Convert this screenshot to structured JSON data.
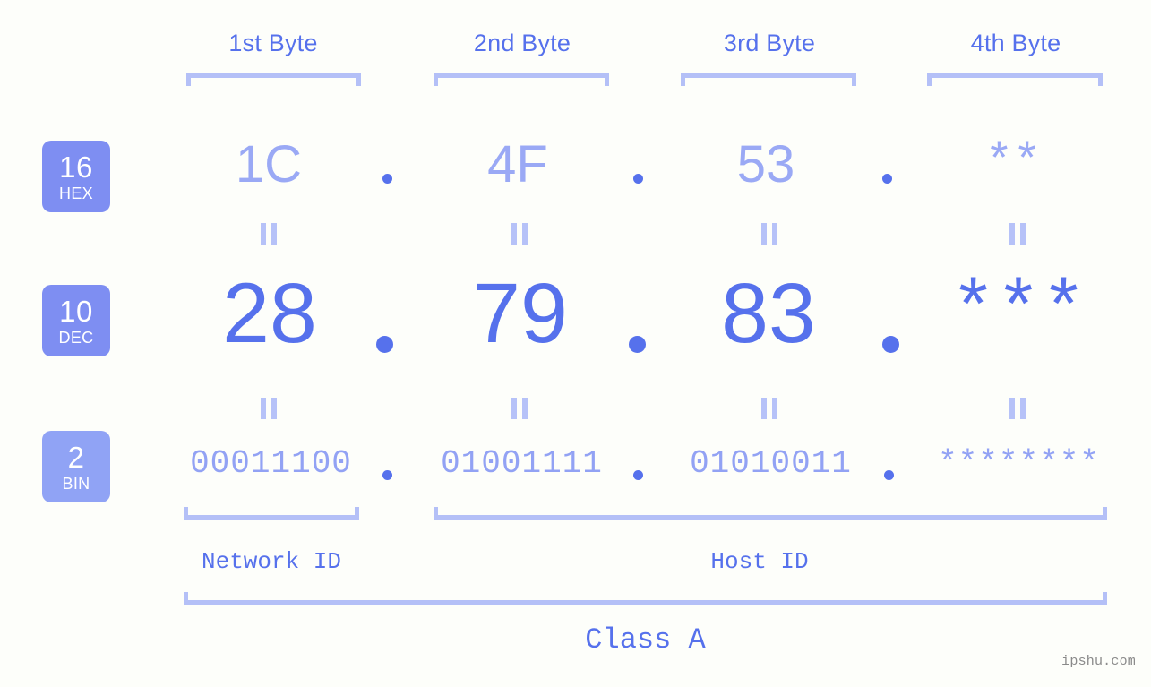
{
  "meta": {
    "background_color": "#fdfefa",
    "accent_strong": "#5671ec",
    "accent_mid": "#7e8ef2",
    "accent_soft": "#b4c0f7",
    "watermark": "ipshu.com"
  },
  "byte_headers": [
    {
      "label": "1st Byte"
    },
    {
      "label": "2nd Byte"
    },
    {
      "label": "3rd Byte"
    },
    {
      "label": "4th Byte"
    }
  ],
  "rows": [
    {
      "base_number": "16",
      "base_label": "HEX",
      "values": [
        "1C",
        "4F",
        "53",
        "**"
      ]
    },
    {
      "base_number": "10",
      "base_label": "DEC",
      "values": [
        "28",
        "79",
        "83",
        "***"
      ]
    },
    {
      "base_number": "2",
      "base_label": "BIN",
      "values": [
        "00011100",
        "01001111",
        "01010011",
        "********"
      ]
    }
  ],
  "separators": {
    "dot": ".",
    "equals": "="
  },
  "footer": {
    "network_id_label": "Network ID",
    "host_id_label": "Host ID",
    "class_label": "Class A"
  }
}
